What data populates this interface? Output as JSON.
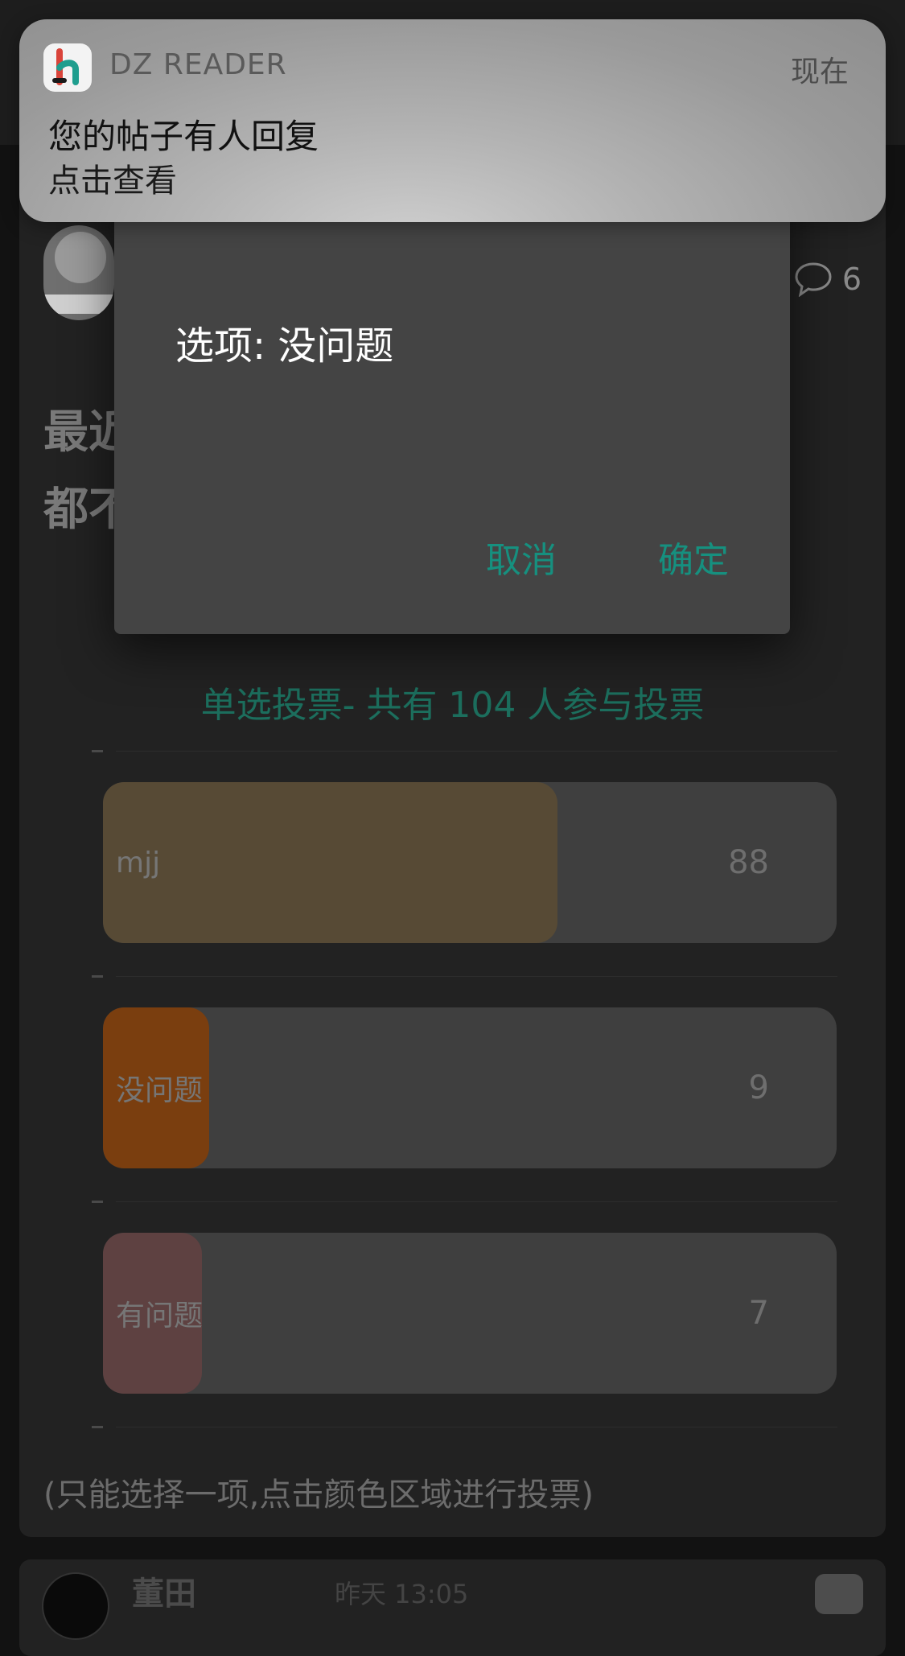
{
  "notification": {
    "app_name": "DZ READER",
    "time": "现在",
    "title": "您的帖子有人回复",
    "body": "点击查看",
    "icon": "dz-reader-app-icon"
  },
  "post": {
    "comment_count": "6",
    "comment_icon": "speech-bubble-icon",
    "title_line1": "最近",
    "title_line2": "都不"
  },
  "dialog": {
    "message": "选项:  没问题",
    "cancel_label": "取消",
    "ok_label": "确定"
  },
  "poll": {
    "header": "单选投票- 共有 104 人参与投票",
    "options": [
      {
        "label": "mjj",
        "count": "88",
        "color": "#574a35",
        "fraction": 0.62
      },
      {
        "label": "没问题",
        "count": "9",
        "color": "#7a3e0f",
        "fraction": 0.145
      },
      {
        "label": "有问题",
        "count": "7",
        "color": "#5e4141",
        "fraction": 0.135
      }
    ],
    "hint": "(只能选择一项,点击颜色区域进行投票)"
  },
  "reply": {
    "name": "董田",
    "time": "昨天 13:05"
  },
  "colors": {
    "accent": "#16907f",
    "poll_header": "#1c6e5d",
    "dialog_bg": "#444444"
  }
}
